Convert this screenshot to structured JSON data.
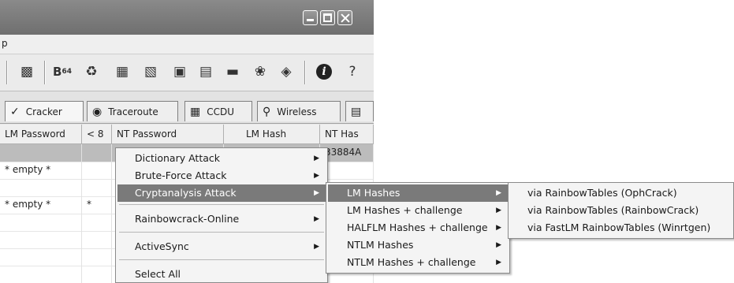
{
  "menubar": {
    "visible_fragment": "p"
  },
  "toolbar": {
    "icons": [
      "network-icon",
      "base64-icon",
      "scan-icon",
      "lsa-icon",
      "vpn-icon",
      "hash-icon",
      "cache-icon",
      "dialup-icon",
      "route-icon",
      "password-icon",
      "info-icon",
      "help-icon"
    ],
    "base64_label": "B",
    "base64_sub": "64",
    "info_glyph": "i",
    "help_glyph": "?"
  },
  "tabs": [
    {
      "label": "Cracker",
      "icon": "cracker-icon"
    },
    {
      "label": "Traceroute",
      "icon": "traceroute-icon"
    },
    {
      "label": "CCDU",
      "icon": "ccdu-icon"
    },
    {
      "label": "Wireless",
      "icon": "wireless-icon"
    }
  ],
  "grid": {
    "columns": [
      "LM Password",
      "< 8",
      "NT Password",
      "LM Hash",
      "NT Has"
    ],
    "rows": [
      {
        "lm_password": "",
        "lt8": "",
        "nt_password": "",
        "lm_hash": "",
        "nt_hash": "33884A",
        "selected": true
      },
      {
        "lm_password": "* empty *",
        "lt8": "",
        "nt_password": "",
        "lm_hash": "",
        "nt_hash": ""
      },
      {
        "lm_password": "",
        "lt8": "",
        "nt_password": "",
        "lm_hash": "",
        "nt_hash": ""
      },
      {
        "lm_password": "* empty *",
        "lt8": "*",
        "nt_password": "",
        "lm_hash": "",
        "nt_hash": ""
      },
      {
        "lm_password": "",
        "lt8": "",
        "nt_password": "",
        "lm_hash": "",
        "nt_hash": ""
      },
      {
        "lm_password": "",
        "lt8": "",
        "nt_password": "",
        "lm_hash": "",
        "nt_hash": ""
      },
      {
        "lm_password": "",
        "lt8": "",
        "nt_password": "",
        "lm_hash": "",
        "nt_hash": ""
      },
      {
        "lm_password": "",
        "lt8": "",
        "nt_password": "",
        "lm_hash": "",
        "nt_hash": ""
      }
    ]
  },
  "context_menu": {
    "items": [
      {
        "label": "Dictionary Attack",
        "submenu": true
      },
      {
        "label": "Brute-Force Attack",
        "submenu": true
      },
      {
        "label": "Cryptanalysis Attack",
        "submenu": true,
        "highlighted": true
      },
      {
        "label": "Rainbowcrack-Online",
        "submenu": true
      },
      {
        "label": "ActiveSync",
        "submenu": true
      },
      {
        "label": "Select All",
        "submenu": false
      }
    ]
  },
  "crypt_submenu": {
    "items": [
      {
        "label": "LM Hashes",
        "highlighted": true
      },
      {
        "label": "LM Hashes + challenge"
      },
      {
        "label": "HALFLM Hashes + challenge"
      },
      {
        "label": "NTLM Hashes"
      },
      {
        "label": "NTLM Hashes + challenge"
      }
    ]
  },
  "lm_submenu": {
    "items": [
      {
        "label": "via RainbowTables (OphCrack)"
      },
      {
        "label": "via RainbowTables (RainbowCrack)"
      },
      {
        "label": "via FastLM RainbowTables (Winrtgen)"
      }
    ]
  },
  "colors": {
    "highlight": "#7a7a7a",
    "titlebar": "#7a7a7a",
    "selected_row": "#bcbcbc"
  }
}
